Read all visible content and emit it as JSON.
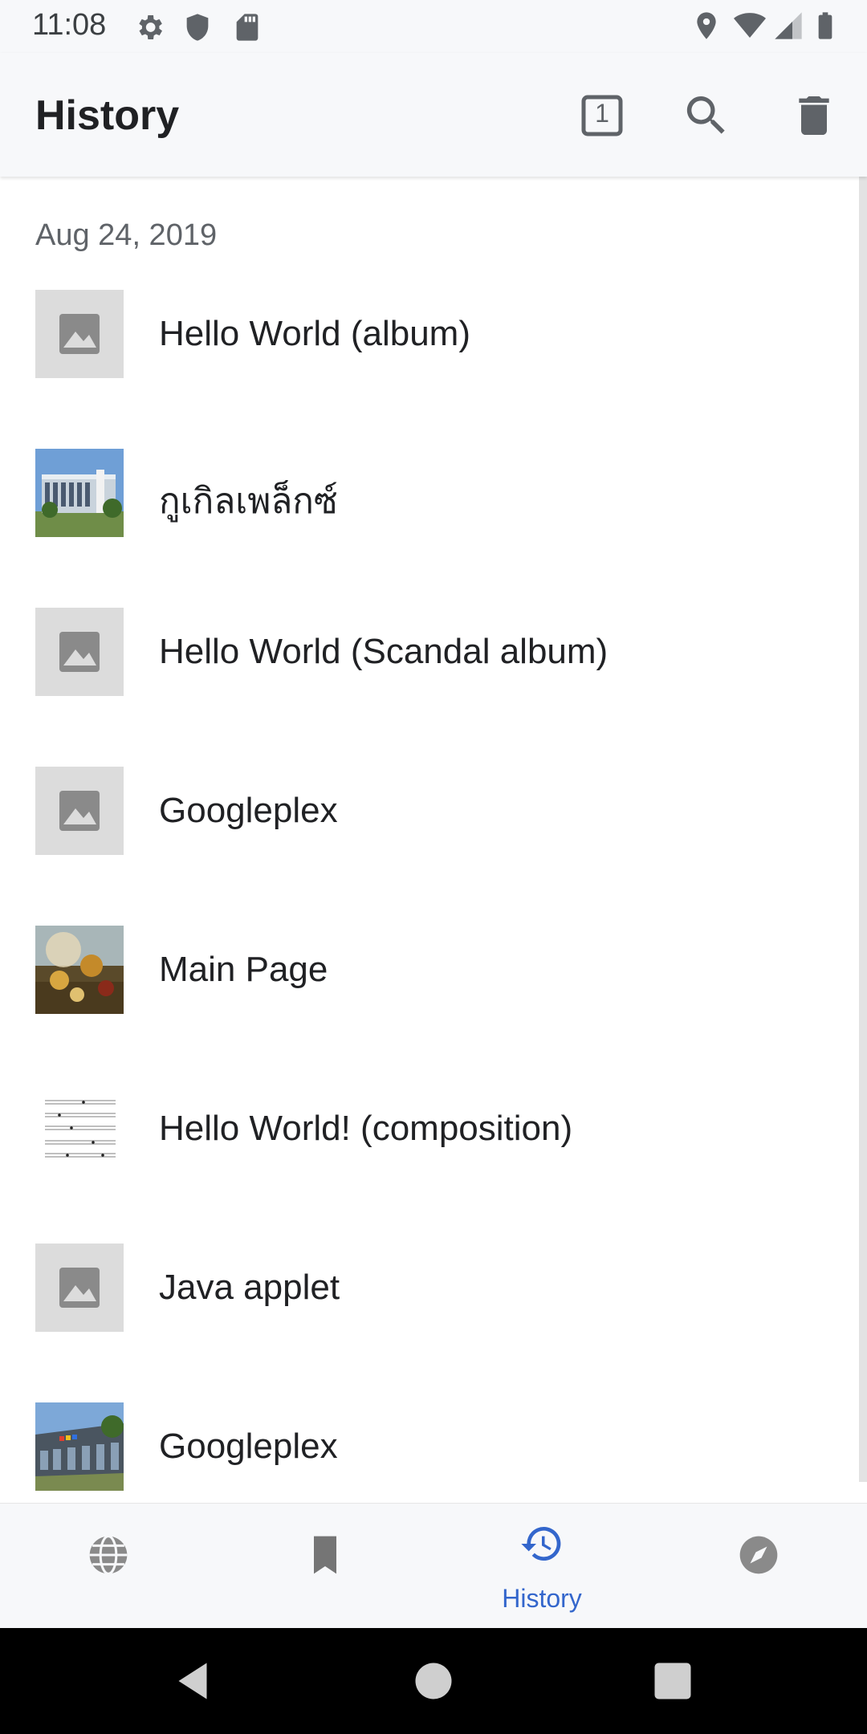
{
  "status_bar": {
    "time": "11:08",
    "left_icons": [
      "gear-icon",
      "shield-icon",
      "sd-card-icon"
    ],
    "right_icons": [
      "location-icon",
      "wifi-icon",
      "signal-icon",
      "battery-icon"
    ]
  },
  "app_bar": {
    "title": "History",
    "tabs_count": "1",
    "actions": [
      "tabs-counter-icon",
      "search-icon",
      "delete-icon"
    ]
  },
  "history": {
    "date_header": "Aug 24, 2019",
    "items": [
      {
        "title": "Hello World (album)",
        "thumbnail": "placeholder-image-icon"
      },
      {
        "title": "กูเกิลเพล็กซ์",
        "thumbnail": "building-photo"
      },
      {
        "title": "Hello World (Scandal album)",
        "thumbnail": "placeholder-image-icon"
      },
      {
        "title": "Googleplex",
        "thumbnail": "placeholder-image-icon"
      },
      {
        "title": "Main Page",
        "thumbnail": "painting-photo"
      },
      {
        "title": "Hello World! (composition)",
        "thumbnail": "sheet-music-photo"
      },
      {
        "title": "Java applet",
        "thumbnail": "placeholder-image-icon"
      },
      {
        "title": "Googleplex",
        "thumbnail": "googleplex-photo"
      }
    ]
  },
  "bottom_nav": {
    "items": [
      {
        "icon": "globe-icon",
        "label": ""
      },
      {
        "icon": "bookmark-icon",
        "label": ""
      },
      {
        "icon": "history-icon",
        "label": "History",
        "active": true
      },
      {
        "icon": "compass-icon",
        "label": ""
      }
    ],
    "active_color": "#3366cc",
    "inactive_color": "#757575"
  },
  "system_nav": [
    "back-icon",
    "home-icon",
    "recents-icon"
  ]
}
